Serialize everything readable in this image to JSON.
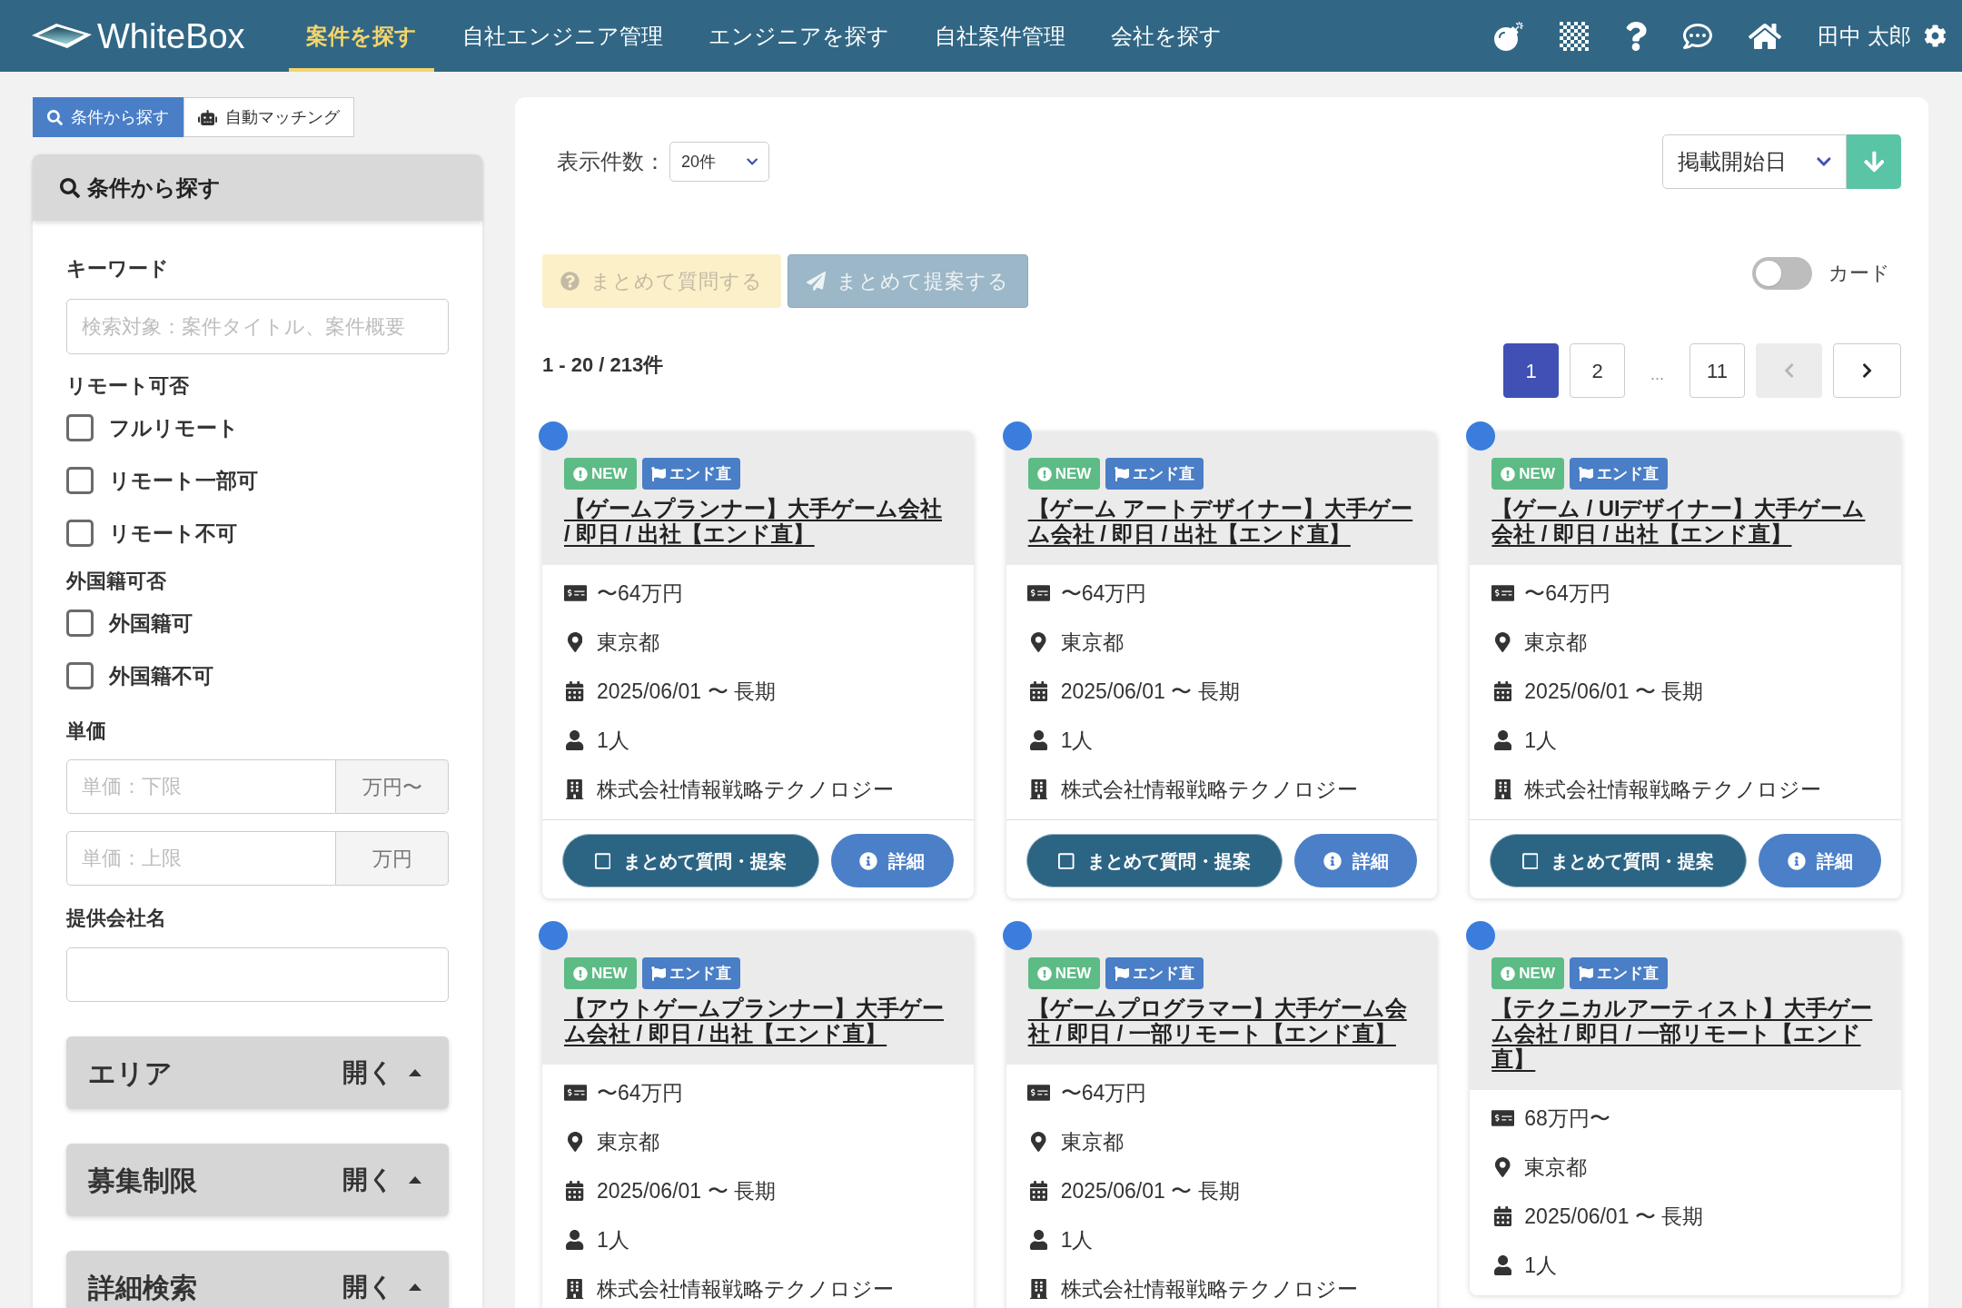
{
  "header": {
    "brand": "WhiteBox",
    "nav": [
      {
        "label": "案件を探す",
        "selected": true
      },
      {
        "label": "自社エンジニア管理",
        "selected": false
      },
      {
        "label": "エンジニアを探す",
        "selected": false
      },
      {
        "label": "自社案件管理",
        "selected": false
      },
      {
        "label": "会社を探す",
        "selected": false
      }
    ],
    "user": "田中 太郎"
  },
  "sidebar": {
    "tabs": [
      {
        "kind": "search",
        "label": "条件から探す",
        "selected": true
      },
      {
        "kind": "robot",
        "label": "自動マッチング",
        "selected": false
      }
    ],
    "panel_title": "条件から探す",
    "keyword": {
      "label": "キーワード",
      "placeholder": "検索対象：案件タイトル、案件概要"
    },
    "filters": [
      {
        "label": "リモート可否",
        "options": [
          {
            "label": "フルリモート",
            "checked": false
          },
          {
            "label": "リモート一部可",
            "checked": false
          },
          {
            "label": "リモート不可",
            "checked": false
          }
        ]
      },
      {
        "label": "外国籍可否",
        "options": [
          {
            "label": "外国籍可",
            "checked": false
          },
          {
            "label": "外国籍不可",
            "checked": false
          }
        ]
      }
    ],
    "price": {
      "label": "単価",
      "fields": [
        {
          "placeholder": "単価：下限",
          "unit": "万円〜"
        },
        {
          "placeholder": "単価：上限",
          "unit": "万円"
        }
      ]
    },
    "company": {
      "label": "提供会社名"
    },
    "sections": [
      {
        "title": "エリア",
        "action": "開く"
      },
      {
        "title": "募集制限",
        "action": "開く"
      },
      {
        "title": "詳細検索",
        "action": "開く"
      }
    ]
  },
  "main": {
    "per_page": {
      "label": "表示件数：",
      "value": "20件"
    },
    "sort": {
      "value": "掲載開始日",
      "descending": true
    },
    "bulk_actions": [
      {
        "kind": "question",
        "label": "まとめて質問する",
        "disabled": true
      },
      {
        "kind": "propose",
        "label": "まとめて提案する",
        "disabled": true
      }
    ],
    "view_toggle": {
      "label": "カード",
      "on": false
    },
    "result_count": "1 - 20 / 213件",
    "pagination": [
      {
        "kind": "page",
        "label": "1",
        "selected": true
      },
      {
        "kind": "page",
        "label": "2",
        "selected": false
      },
      {
        "kind": "gap",
        "label": "..."
      },
      {
        "kind": "page",
        "label": "11",
        "selected": false
      },
      {
        "kind": "prev",
        "disabled": true
      },
      {
        "kind": "next",
        "disabled": false
      }
    ],
    "cards": [
      {
        "unread": true,
        "badges": [
          {
            "kind": "new",
            "label": "NEW"
          },
          {
            "kind": "direct",
            "label": "エンド直"
          }
        ],
        "title": "【ゲームプランナー】大手ゲーム会社 / 即日 / 出社【エンド直】",
        "details": [
          {
            "kind": "salary",
            "text": "〜64万円"
          },
          {
            "kind": "location",
            "text": "東京都"
          },
          {
            "kind": "period",
            "text": "2025/06/01 〜 長期"
          },
          {
            "kind": "headcount",
            "text": "1人"
          },
          {
            "kind": "company",
            "text": "株式会社情報戦略テクノロジー"
          }
        ],
        "actions": [
          {
            "kind": "bulk",
            "label": "まとめて質問・提案",
            "checked": false
          },
          {
            "kind": "detail",
            "label": "詳細"
          }
        ]
      },
      {
        "unread": true,
        "badges": [
          {
            "kind": "new",
            "label": "NEW"
          },
          {
            "kind": "direct",
            "label": "エンド直"
          }
        ],
        "title": "【ゲーム アートデザイナー】大手ゲーム会社 / 即日 / 出社【エンド直】",
        "details": [
          {
            "kind": "salary",
            "text": "〜64万円"
          },
          {
            "kind": "location",
            "text": "東京都"
          },
          {
            "kind": "period",
            "text": "2025/06/01 〜 長期"
          },
          {
            "kind": "headcount",
            "text": "1人"
          },
          {
            "kind": "company",
            "text": "株式会社情報戦略テクノロジー"
          }
        ],
        "actions": [
          {
            "kind": "bulk",
            "label": "まとめて質問・提案",
            "checked": false
          },
          {
            "kind": "detail",
            "label": "詳細"
          }
        ]
      },
      {
        "unread": true,
        "badges": [
          {
            "kind": "new",
            "label": "NEW"
          },
          {
            "kind": "direct",
            "label": "エンド直"
          }
        ],
        "title": "【ゲーム / UIデザイナー】大手ゲーム会社 / 即日 / 出社【エンド直】",
        "details": [
          {
            "kind": "salary",
            "text": "〜64万円"
          },
          {
            "kind": "location",
            "text": "東京都"
          },
          {
            "kind": "period",
            "text": "2025/06/01 〜 長期"
          },
          {
            "kind": "headcount",
            "text": "1人"
          },
          {
            "kind": "company",
            "text": "株式会社情報戦略テクノロジー"
          }
        ],
        "actions": [
          {
            "kind": "bulk",
            "label": "まとめて質問・提案",
            "checked": false
          },
          {
            "kind": "detail",
            "label": "詳細"
          }
        ]
      },
      {
        "unread": true,
        "badges": [
          {
            "kind": "new",
            "label": "NEW"
          },
          {
            "kind": "direct",
            "label": "エンド直"
          }
        ],
        "title": "【アウトゲームプランナー】大手ゲーム会社 / 即日 / 出社【エンド直】",
        "details": [
          {
            "kind": "salary",
            "text": "〜64万円"
          },
          {
            "kind": "location",
            "text": "東京都"
          },
          {
            "kind": "period",
            "text": "2025/06/01 〜 長期"
          },
          {
            "kind": "headcount",
            "text": "1人"
          },
          {
            "kind": "company",
            "text": "株式会社情報戦略テクノロジー"
          }
        ]
      },
      {
        "unread": true,
        "badges": [
          {
            "kind": "new",
            "label": "NEW"
          },
          {
            "kind": "direct",
            "label": "エンド直"
          }
        ],
        "title": "【ゲームプログラマー】大手ゲーム会社 / 即日 / 一部リモート【エンド直】",
        "details": [
          {
            "kind": "salary",
            "text": "〜64万円"
          },
          {
            "kind": "location",
            "text": "東京都"
          },
          {
            "kind": "period",
            "text": "2025/06/01 〜 長期"
          },
          {
            "kind": "headcount",
            "text": "1人"
          },
          {
            "kind": "company",
            "text": "株式会社情報戦略テクノロジー"
          }
        ]
      },
      {
        "unread": true,
        "badges": [
          {
            "kind": "new",
            "label": "NEW"
          },
          {
            "kind": "direct",
            "label": "エンド直"
          }
        ],
        "title": "【テクニカルアーティスト】大手ゲーム会社 / 即日 / 一部リモート【エンド直】",
        "details": [
          {
            "kind": "salary",
            "text": "68万円〜"
          },
          {
            "kind": "location",
            "text": "東京都"
          },
          {
            "kind": "period",
            "text": "2025/06/01 〜 長期"
          },
          {
            "kind": "headcount",
            "text": "1人"
          }
        ]
      }
    ]
  }
}
